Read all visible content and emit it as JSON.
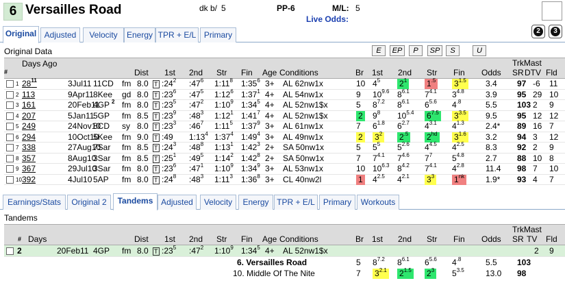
{
  "header": {
    "number": "6",
    "horse": "Versailles Road",
    "dk_label": "dk b/",
    "dk_value": "5",
    "pp": "PP-6",
    "ml_label": "M/L:",
    "ml_value": "5",
    "live_odds": "Live Odds:"
  },
  "tabs1": [
    "Original",
    "Adjusted",
    "Velocity",
    "Energy",
    "TPR + E/L",
    "Primary"
  ],
  "circle_buttons": [
    "2",
    "3"
  ],
  "section1_title": "Original Data",
  "filter_buttons": [
    "E",
    "EP",
    "P",
    "SP",
    "S",
    "U"
  ],
  "grid1": {
    "headers": {
      "hash": "#",
      "days_ago": "Days Ago",
      "dist": "Dist",
      "first": "1st",
      "second": "2nd",
      "str": "Str",
      "fin": "Fin",
      "age": "Age",
      "conditions": "Conditions",
      "br": "Br",
      "c1": "1st",
      "c2": "2nd",
      "cstr": "Str",
      "cfin": "Fin",
      "odds": "Odds",
      "trkmast": "TrkMast",
      "sr": "SR",
      "dtv": "DTV",
      "fld": "Fld"
    },
    "rows": [
      {
        "n": "1",
        "days": "28",
        "dsup": "11",
        "date": "3Jul11",
        "race": "11CD",
        "surf": "fm",
        "dist": "8.0",
        "t1": ":24",
        "t1s": "2",
        "t2": ":47",
        "t2s": "6",
        "tst": "1:11",
        "tsts": "8",
        "tfin": "1:35",
        "tfins": "6",
        "age": "3+",
        "cond": "AL 62nw1x",
        "br": "10",
        "p1": "4",
        "p1s": "5",
        "p2": "2",
        "p2s": "1",
        "ps": "1",
        "pss": ".5",
        "pf": "3",
        "pfs": "1.5",
        "odds": "3.4",
        "sr": "97",
        "dtv": "-6",
        "fld": "11"
      },
      {
        "n": "2",
        "days": "113",
        "dsup": "",
        "date": "9Apr11",
        "race": "8Kee",
        "surf": "gd",
        "dist": "8.0",
        "t1": ":23",
        "t1s": "6",
        "t2": ":47",
        "t2s": "5",
        "tst": "1:12",
        "tsts": "6",
        "tfin": "1:37",
        "tfins": "1",
        "age": "4+",
        "cond": "AL 54nw1x",
        "br": "9",
        "p1": "10",
        "p1s": "9.6",
        "p2": "8",
        "p2s": "6.1",
        "ps": "7",
        "pss": "4.1",
        "pf": "3",
        "pfs": "4.8",
        "odds": "3.9",
        "sr": "95",
        "dtv": "29",
        "fld": "10"
      },
      {
        "n": "3",
        "days": "161",
        "dsup": "",
        "date": "20Feb11",
        "race": "4GP",
        "surf": "fm",
        "dist": "8.0",
        "t1": ":23",
        "t1s": "5",
        "t2": ":47",
        "t2s": "2",
        "tst": "1:10",
        "tsts": "9",
        "tfin": "1:34",
        "tfins": "5",
        "age": "4+",
        "cond": "AL 52nw1$x",
        "br": "5",
        "p1": "8",
        "p1s": "7.2",
        "p2": "8",
        "p2s": "6.1",
        "ps": "6",
        "pss": "5.6",
        "pf": "4",
        "pfs": ".8",
        "odds": "5.5",
        "sr": "103",
        "dtv": "2",
        "fld": "9"
      },
      {
        "n": "4",
        "days": "207",
        "dsup": "",
        "date": "5Jan11",
        "race": "5GP",
        "surf": "fm",
        "dist": "8.5",
        "t1": ":23",
        "t1s": "9",
        "t2": ":48",
        "t2s": "3",
        "tst": "1:12",
        "tsts": "1",
        "tfin": "1:41",
        "tfins": "7",
        "age": "4+",
        "cond": "AL 52nw1$x",
        "br": "2",
        "p1": "9",
        "p1s": "8",
        "p2": "10",
        "p2s": "5.4",
        "ps": "6",
        "pss": "7.5",
        "pf": "3",
        "pfs": "3.5",
        "odds": "9.5",
        "sr": "95",
        "dtv": "12",
        "fld": "12"
      },
      {
        "n": "5",
        "days": "249",
        "dsup": "",
        "date": "24Nov10",
        "race": "8CD",
        "surf": "sy",
        "dist": "8.0",
        "t1": ":23",
        "t1s": "3",
        "t2": ":46",
        "t2s": "7",
        "tst": "1:11",
        "tsts": "5",
        "tfin": "1:37",
        "tfins": "9",
        "age": "3+",
        "cond": "AL 61nw1x",
        "br": "7",
        "p1": "6",
        "p1s": "1.8",
        "p2": "6",
        "p2s": "2.7",
        "ps": "4",
        "pss": "3.1",
        "pf": "4",
        "pfs": "1.3",
        "odds": "2.4*",
        "sr": "89",
        "dtv": "16",
        "fld": "7"
      },
      {
        "n": "6",
        "days": "294",
        "dsup": "",
        "date": "10Oct10",
        "race": "5Kee",
        "surf": "fm",
        "dist": "9.0",
        "t1": ":49",
        "t1s": "",
        "t2": "1:13",
        "t2s": "4",
        "tst": "1:37",
        "tsts": "4",
        "tfin": "1:49",
        "tfins": "4",
        "age": "3+",
        "cond": "AL 49nw1x",
        "br": "2",
        "p1": "3",
        "p1s": "2",
        "p2": "2",
        "p2s": ".5",
        "ps": "2",
        "pss": "hd",
        "pf": "3",
        "pfs": "1.6",
        "odds": "3.2",
        "sr": "94",
        "dtv": "3",
        "fld": "12"
      },
      {
        "n": "7",
        "days": "338",
        "dsup": "",
        "date": "27Aug10",
        "race": "7Sar",
        "surf": "fm",
        "dist": "8.5",
        "t1": ":24",
        "t1s": "3",
        "t2": ":48",
        "t2s": "8",
        "tst": "1:13",
        "tsts": "1",
        "tfin": "1:42",
        "tfins": "3",
        "age": "2+",
        "cond": "SA 50nw1x",
        "br": "5",
        "p1": "5",
        "p1s": "5",
        "p2": "5",
        "p2s": "2.6",
        "ps": "4",
        "pss": "4.5",
        "pf": "4",
        "pfs": "2.5",
        "odds": "8.3",
        "sr": "92",
        "dtv": "2",
        "fld": "9"
      },
      {
        "n": "8",
        "days": "357",
        "dsup": "",
        "date": "8Aug10",
        "race": "3Sar",
        "surf": "fm",
        "dist": "8.5",
        "t1": ":25",
        "t1s": "1",
        "t2": ":49",
        "t2s": "5",
        "tst": "1:14",
        "tsts": "2",
        "tfin": "1:42",
        "tfins": "8",
        "age": "2+",
        "cond": "SA 50nw1x",
        "br": "7",
        "p1": "7",
        "p1s": "4.1",
        "p2": "7",
        "p2s": "4.6",
        "ps": "7",
        "pss": "7",
        "pf": "5",
        "pfs": "4.8",
        "odds": "2.7",
        "sr": "88",
        "dtv": "10",
        "fld": "8"
      },
      {
        "n": "9",
        "days": "367",
        "dsup": "",
        "date": "29Jul10",
        "race": "3Sar",
        "surf": "fm",
        "dist": "8.0",
        "t1": ":23",
        "t1s": "6",
        "t2": ":47",
        "t2s": "1",
        "tst": "1:10",
        "tsts": "9",
        "tfin": "1:34",
        "tfins": "9",
        "age": "3+",
        "cond": "AL 53nw1x",
        "br": "10",
        "p1": "10",
        "p1s": "6.3",
        "p2": "8",
        "p2s": "4.2",
        "ps": "7",
        "pss": "4.1",
        "pf": "4",
        "pfs": "2.8",
        "odds": "11.4",
        "sr": "98",
        "dtv": "7",
        "fld": "10"
      },
      {
        "n": "10",
        "days": "392",
        "dsup": "",
        "date": "4Jul10",
        "race": "5AP",
        "surf": "fm",
        "dist": "8.0",
        "t1": ":24",
        "t1s": "8",
        "t2": ":48",
        "t2s": "3",
        "tst": "1:11",
        "tsts": "3",
        "tfin": "1:36",
        "tfins": "8",
        "age": "3+",
        "cond": "CL 40nw2l",
        "br": "1",
        "p1": "4",
        "p1s": "2.5",
        "p2": "4",
        "p2s": "2.1",
        "ps": "3",
        "pss": "3",
        "pf": "1",
        "pfs": "nk",
        "odds": "1.9*",
        "sr": "93",
        "dtv": "4",
        "fld": "7"
      }
    ]
  },
  "tabs2": [
    "Earnings/Stats",
    "Original 2",
    "Tandems",
    "Adjusted",
    "Velocity",
    "Energy",
    "TPR + E/L",
    "Primary",
    "Workouts"
  ],
  "section2_title": "Tandems",
  "grid2": {
    "headers": {
      "hash": "#",
      "days": "Days",
      "dist": "Dist",
      "first": "1st",
      "second": "2nd",
      "str": "Str",
      "fin": "Fin",
      "age": "Age",
      "conditions": "Conditions",
      "br": "Br",
      "c1": "1st",
      "c2": "2nd",
      "cstr": "Str",
      "cfin": "Fin",
      "odds": "Odds",
      "trkmast": "TrkMast",
      "sr": "SR",
      "tv": "TV",
      "fld": "Fld"
    },
    "row": {
      "n": "2",
      "date": "20Feb11",
      "race": "4GP",
      "surf": "fm",
      "dist": "8.0",
      "t1": ":23",
      "t1s": "5",
      "t2": ":47",
      "t2s": "2",
      "tst": "1:10",
      "tsts": "9",
      "tfin": "1:34",
      "tfins": "5",
      "age": "4+",
      "cond": "AL 52nw1$x",
      "sr": "",
      "tv": "2",
      "fld": "9"
    },
    "sub": [
      {
        "label": "6.  Versailles Road",
        "br": "5",
        "p1": "8",
        "p1s": "7.2",
        "p2": "8",
        "p2s": "6.1",
        "ps": "6",
        "pss": "5.6",
        "pf": "4",
        "pfs": ".8",
        "odds": "5.5",
        "sr": "103"
      },
      {
        "label": "10.  Middle Of The Nite",
        "br": "7",
        "p1": "3",
        "p1s": "2.1",
        "p2": "2",
        "p2s": "1.5",
        "ps": "2",
        "pss": "3",
        "pf": "5",
        "pfs": "3.5",
        "odds": "13.0",
        "sr": "98"
      }
    ]
  },
  "colors": {
    "green": "#2ee66e",
    "yellow": "#ffff4d",
    "red": "#f08080",
    "tab_text": "#1a4aa0",
    "selected_row": "#d9f0d9"
  }
}
